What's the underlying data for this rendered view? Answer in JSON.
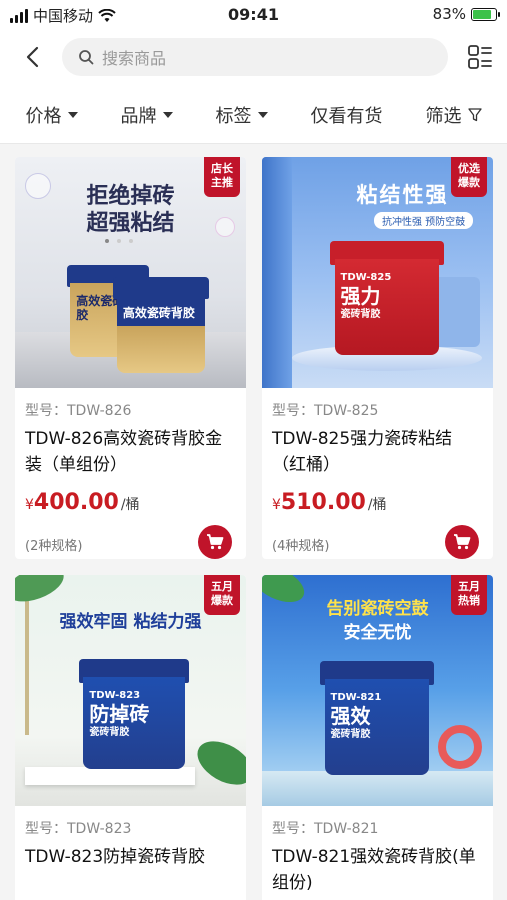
{
  "status_bar": {
    "carrier": "中国移动",
    "time": "09:41",
    "battery": "83%"
  },
  "search": {
    "placeholder": "搜索商品"
  },
  "filters": [
    {
      "label": "价格",
      "dropdown": true
    },
    {
      "label": "品牌",
      "dropdown": true
    },
    {
      "label": "标签",
      "dropdown": true
    },
    {
      "label": "仅看有货",
      "dropdown": false
    },
    {
      "label": "筛选",
      "dropdown": false
    }
  ],
  "products": [
    {
      "ribbon": [
        "店长",
        "主推"
      ],
      "headline": [
        "拒绝掉砖",
        "超强粘结"
      ],
      "bucket_text": [
        "高效瓷砖背胶",
        "高效瓷砖背胶"
      ],
      "model": "型号：TDW-826",
      "title": "TDW-826高效瓷砖背胶金装（单组份）",
      "currency": "¥",
      "price": "400.00",
      "unit": "/桶",
      "spec": "(2种规格)"
    },
    {
      "ribbon": [
        "优选",
        "爆款"
      ],
      "headline": [
        "粘结性强"
      ],
      "subline": "抗冲性强  预防空鼓",
      "bucket_text": [
        "TDW-825",
        "强力",
        "瓷砖背胶"
      ],
      "model": "型号：TDW-825",
      "title": "TDW-825强力瓷砖粘结（红桶）",
      "currency": "¥",
      "price": "510.00",
      "unit": "/桶",
      "spec": "(4种规格)"
    },
    {
      "ribbon": [
        "五月",
        "爆款"
      ],
      "headline": [
        "强效牢固  粘结力强"
      ],
      "bucket_text": [
        "TDW-823",
        "防掉砖",
        "瓷砖背胶"
      ],
      "model": "型号：TDW-823",
      "title": "TDW-823防掉瓷砖背胶"
    },
    {
      "ribbon": [
        "五月",
        "热销"
      ],
      "headline": [
        "告别瓷砖空鼓",
        "安全无忧"
      ],
      "bucket_text": [
        "TDW-821",
        "强效",
        "瓷砖背胶"
      ],
      "model": "型号：TDW-821",
      "title": "TDW-821强效瓷砖背胶(单组份)"
    }
  ],
  "colors": {
    "accent": "#c0142a",
    "price": "#c81c22"
  }
}
